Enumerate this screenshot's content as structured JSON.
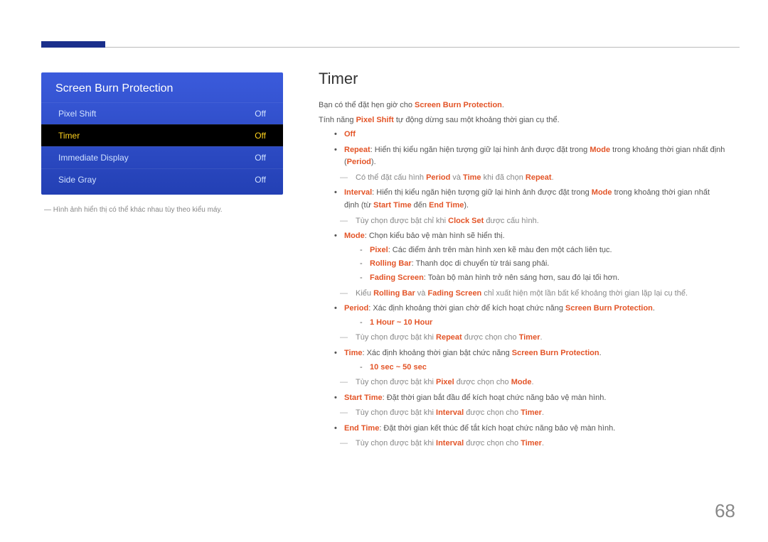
{
  "page_number": "68",
  "osd": {
    "title": "Screen Burn Protection",
    "rows": [
      {
        "label": "Pixel Shift",
        "value": "Off",
        "selected": false
      },
      {
        "label": "Timer",
        "value": "Off",
        "selected": true
      },
      {
        "label": "Immediate Display",
        "value": "Off",
        "selected": false
      },
      {
        "label": "Side Gray",
        "value": "Off",
        "selected": false
      }
    ]
  },
  "figcap_prefix": "― ",
  "figcap": "Hình ảnh hiển thị có thể khác nhau tùy theo kiểu máy.",
  "section_title": "Timer",
  "intro1_a": "Bạn có thể đặt hẹn giờ cho ",
  "intro1_b": "Screen Burn Protection",
  "intro1_c": ".",
  "intro2_a": "Tính năng ",
  "intro2_b": "Pixel Shift",
  "intro2_c": " tự động dừng sau một khoảng thời gian cụ thể.",
  "li_off": "Off",
  "li_repeat_a": "Repeat",
  "li_repeat_b": ": Hiển thị kiểu ngăn hiện tượng giữ lại hình ảnh được đặt trong ",
  "li_repeat_c": "Mode",
  "li_repeat_d": " trong khoảng thời gian nhất định (",
  "li_repeat_e": "Period",
  "li_repeat_f": ").",
  "note_repeat_a": "Có thể đặt cấu hình ",
  "note_repeat_b": "Period",
  "note_repeat_c": " và ",
  "note_repeat_d": "Time",
  "note_repeat_e": " khi đã chọn ",
  "note_repeat_f": "Repeat",
  "note_repeat_g": ".",
  "li_interval_a": "Interval",
  "li_interval_b": ": Hiển thị kiểu ngăn hiện tượng giữ lại hình ảnh được đặt trong ",
  "li_interval_c": "Mode",
  "li_interval_d": " trong khoảng thời gian nhất định (từ ",
  "li_interval_e": "Start Time",
  "li_interval_f": " đến ",
  "li_interval_g": "End Time",
  "li_interval_h": ").",
  "note_interval_a": "Tùy chọn được bật chỉ khi ",
  "note_interval_b": "Clock Set",
  "note_interval_c": " được cấu hình.",
  "li_mode_a": "Mode",
  "li_mode_b": ": Chọn kiểu bảo vệ màn hình sẽ hiển thị.",
  "sub_pixel_a": "Pixel",
  "sub_pixel_b": ": Các điểm ảnh trên màn hình xen kẽ màu đen một cách liên tục.",
  "sub_rolling_a": "Rolling Bar",
  "sub_rolling_b": ": Thanh dọc di chuyển từ trái sang phải.",
  "sub_fading_a": "Fading Screen",
  "sub_fading_b": ": Toàn bộ màn hình trở nên sáng hơn, sau đó lại tối hơn.",
  "note_mode_a": "Kiểu ",
  "note_mode_b": "Rolling Bar",
  "note_mode_c": " và ",
  "note_mode_d": "Fading Screen",
  "note_mode_e": " chỉ xuất hiện một lần bất kể khoảng thời gian lặp lại cụ thể.",
  "li_period_a": "Period",
  "li_period_b": ": Xác định khoảng thời gian chờ để kích hoạt chức năng ",
  "li_period_c": "Screen Burn Protection",
  "li_period_d": ".",
  "sub_hour": "1 Hour ~ 10 Hour",
  "note_period_a": "Tùy chọn được bật khi ",
  "note_period_b": "Repeat",
  "note_period_c": " được chọn cho ",
  "note_period_d": "Timer",
  "note_period_e": ".",
  "li_time_a": "Time",
  "li_time_b": ": Xác định khoảng thời gian bật chức năng ",
  "li_time_c": "Screen Burn Protection",
  "li_time_d": ".",
  "sub_sec": "10 sec ~ 50 sec",
  "note_time_a": "Tùy chọn được bật khi ",
  "note_time_b": "Pixel",
  "note_time_c": " được chọn cho ",
  "note_time_d": "Mode",
  "note_time_e": ".",
  "li_start_a": "Start Time",
  "li_start_b": ": Đặt thời gian bắt đầu để kích hoạt chức năng bảo vệ màn hình.",
  "note_start_a": "Tùy chọn được bật khi ",
  "note_start_b": "Interval",
  "note_start_c": " được chọn cho ",
  "note_start_d": "Timer",
  "note_start_e": ".",
  "li_end_a": "End Time",
  "li_end_b": ": Đặt thời gian kết thúc để tắt kích hoạt chức năng bảo vệ màn hình.",
  "note_end_a": "Tùy chọn được bật khi ",
  "note_end_b": "Interval",
  "note_end_c": " được chọn cho ",
  "note_end_d": "Timer",
  "note_end_e": "."
}
